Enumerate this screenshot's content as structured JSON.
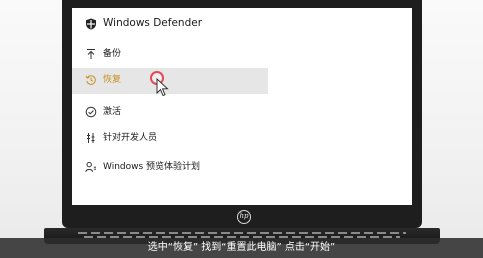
{
  "settings_nav": {
    "title": "Windows Defender",
    "items": [
      {
        "icon": "backup-arrow-icon",
        "label": "备份"
      },
      {
        "icon": "recovery-history-icon",
        "label": "恢复"
      },
      {
        "icon": "activation-check-icon",
        "label": "激活"
      },
      {
        "icon": "developer-tools-icon",
        "label": "针对开发人员"
      },
      {
        "icon": "insider-people-icon",
        "label": "Windows 预览体验计划"
      }
    ],
    "selected_item": "恢复"
  },
  "caption": "选中“恢复” 找到“重置此电脑” 点击“开始”",
  "laptop_logo": "hp",
  "colors": {
    "selected_label": "#c7901e",
    "selected_background": "#e6e6e6",
    "click_ring": "#e44a55",
    "caption_bar": "#2d2d2d"
  }
}
